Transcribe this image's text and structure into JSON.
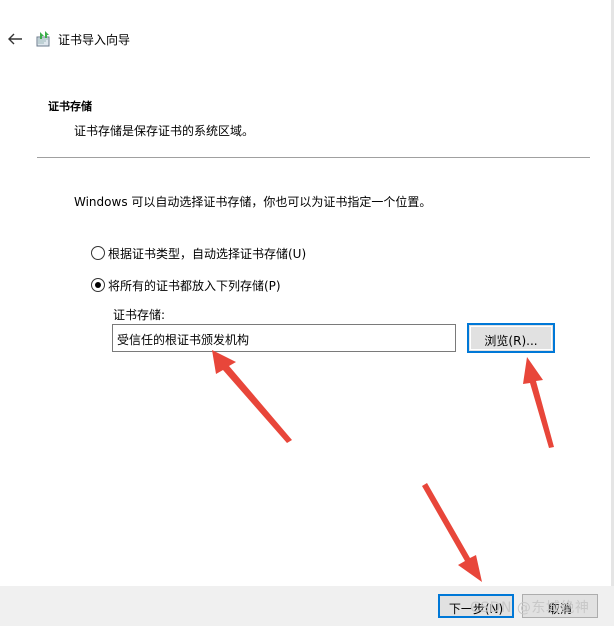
{
  "window": {
    "title": "证书导入向导",
    "back_icon": "back-arrow-icon",
    "app_icon": "certificate-wizard-icon"
  },
  "section": {
    "title": "证书存储",
    "description": "证书存储是保存证书的系统区域。"
  },
  "intro": "Windows 可以自动选择证书存储，你也可以为证书指定一个位置。",
  "options": {
    "auto": {
      "label": "根据证书类型，自动选择证书存储(U)",
      "selected": false
    },
    "manual": {
      "label": "将所有的证书都放入下列存储(P)",
      "selected": true
    }
  },
  "store": {
    "label": "证书存储:",
    "value": "受信任的根证书颁发机构",
    "browse_label": "浏览(R)..."
  },
  "footer": {
    "next_label": "下一步(N)",
    "cancel_label": "取消"
  },
  "watermark": "CSDN @东城绝神",
  "colors": {
    "accent": "#0078d7",
    "annotation_arrow": "#e8463a",
    "footer_bg": "#f0f0f0"
  }
}
